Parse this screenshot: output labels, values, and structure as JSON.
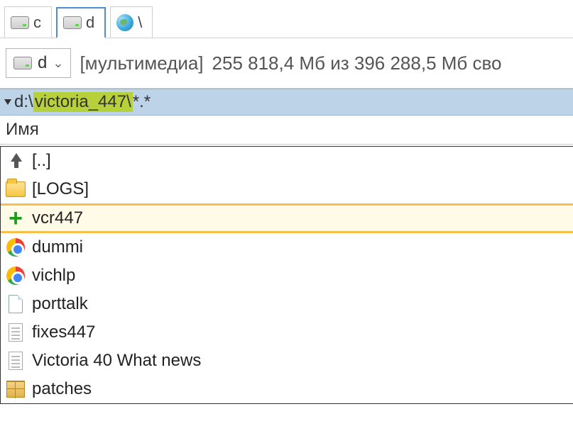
{
  "tabs": {
    "c": "c",
    "d": "d",
    "net": "\\"
  },
  "drive": {
    "letter": "d",
    "label": "[мультимедиа]",
    "space": "255 818,4 Мб из 396 288,5 Мб сво"
  },
  "path": {
    "prefix": "d:\\",
    "highlighted": "victoria_447\\",
    "suffix": "*.*"
  },
  "columns": {
    "name": "Имя"
  },
  "rows": {
    "up": "[..]",
    "logs": "[LOGS]",
    "vcr": "vcr447",
    "dummi": "dummi",
    "vichlp": "vichlp",
    "porttalk": "porttalk",
    "fixes": "fixes447",
    "whatnews": "Victoria 40 What news",
    "patches": "patches"
  }
}
